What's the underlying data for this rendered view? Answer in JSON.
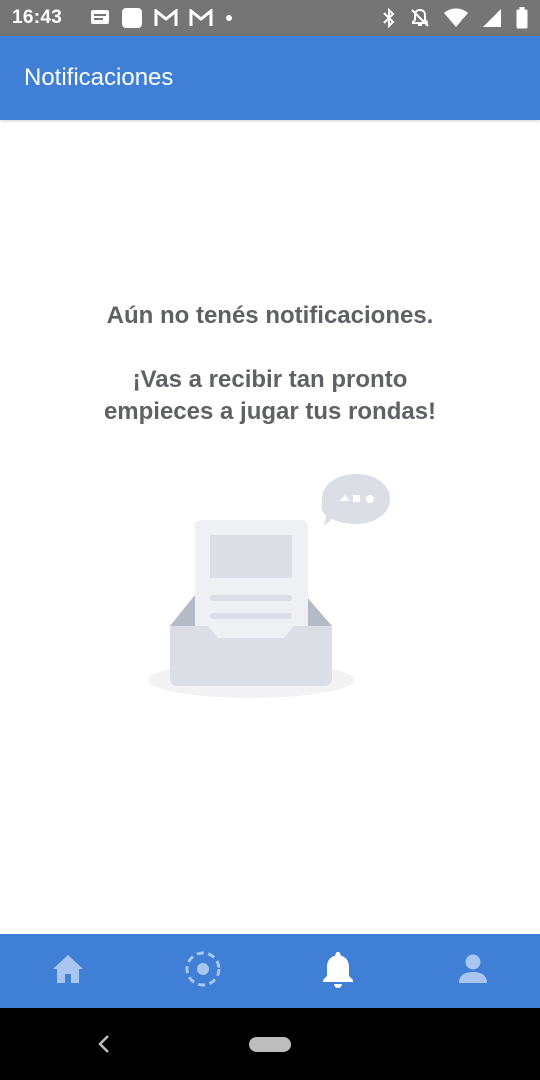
{
  "status_bar": {
    "time": "16:43",
    "left_icons": [
      "messages-icon",
      "square-app-icon",
      "gmail-icon",
      "gmail-icon",
      "dot-icon"
    ],
    "right_icons": [
      "bluetooth-icon",
      "mute-icon",
      "wifi-icon",
      "signal-icon",
      "battery-icon"
    ]
  },
  "app_bar": {
    "title": "Notificaciones",
    "color": "#3f7fd6"
  },
  "empty_state": {
    "line1": "Aún no tenés notificaciones.",
    "line2a": "¡Vas a recibir tan pronto",
    "line2b": "empieces a jugar tus rondas!",
    "illustration": "empty-inbox-illustration"
  },
  "bottom_nav": {
    "items": [
      {
        "icon": "home-icon",
        "active": false
      },
      {
        "icon": "rounds-icon",
        "active": false
      },
      {
        "icon": "bell-icon",
        "active": true
      },
      {
        "icon": "profile-icon",
        "active": false
      }
    ],
    "active_color": "#ffffff",
    "inactive_color": "#a9c6f0"
  },
  "system_nav": {
    "icons": [
      "back-icon",
      "home-pill"
    ]
  }
}
